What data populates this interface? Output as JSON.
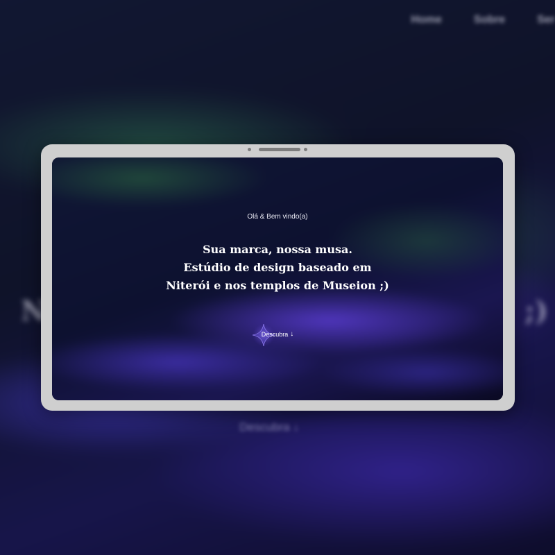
{
  "background": {
    "nav": [
      "Home",
      "Sobre",
      "Ser"
    ],
    "headline_left": "N",
    "headline_right": ";)",
    "cta_label": "Descubra ↓"
  },
  "hero": {
    "greeting": "Olá & Bem vindo(a)",
    "headline_lines": [
      "Sua marca, nossa musa.",
      "Estúdio de design baseado em",
      "Niterói e nos templos de Museion ;)"
    ],
    "cta_label": "Descubra",
    "cta_icon": "arrow-down-icon"
  },
  "colors": {
    "tablet_frame": "#cfcfcf",
    "screen_dark": "#0a0b20",
    "accent_purple": "#5a3cd2",
    "accent_green": "#23503c"
  }
}
